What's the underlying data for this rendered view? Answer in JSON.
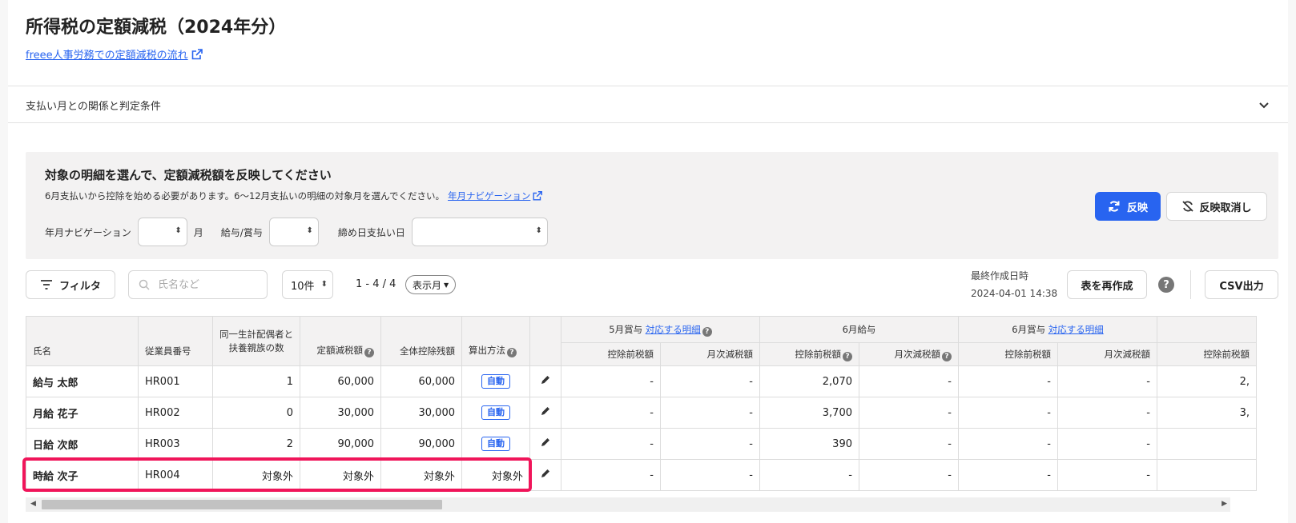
{
  "header": {
    "title": "所得税の定額減税（2024年分）",
    "flow_link": "freee人事労務での定額減税の流れ"
  },
  "accordion": {
    "label": "支払い月との関係と判定条件"
  },
  "panel": {
    "heading": "対象の明細を選んで、定額減税額を反映してください",
    "description": "6月支払いから控除を始める必要があります。6〜12月支払いの明細の対象月を選んでください。",
    "nav_link": "年月ナビゲーション",
    "fields": {
      "nav_label": "年月ナビゲーション",
      "month_unit": "月",
      "pay_type_label": "給与/賞与",
      "closing_label": "締め日支払い日"
    },
    "apply_button": "反映",
    "cancel_button": "反映取消し"
  },
  "toolbar": {
    "filter": "フィルタ",
    "search_placeholder": "氏名など",
    "per_page": "10件",
    "range": "1 - 4 / 4",
    "display_month": "表示月",
    "last_created_label": "最終作成日時",
    "last_created_value": "2024-04-01 14:38",
    "regen": "表を再作成",
    "csv": "CSV出力"
  },
  "table": {
    "headers": {
      "name": "氏名",
      "emp_no": "従業員番号",
      "dependents_l1": "同一生計配偶者と",
      "dependents_l2": "扶養親族の数",
      "reduction": "定額減税額",
      "total": "全体控除残額",
      "method": "算出方法",
      "may_bonus": "5月賞与",
      "may_bonus_link": "対応する明細",
      "jun_salary": "6月給与",
      "jun_bonus": "6月賞与",
      "jun_bonus_link": "対応する明細",
      "pre_tax": "控除前税額",
      "monthly_reduction": "月次減税額"
    },
    "rows": [
      {
        "name": "給与 太郎",
        "emp_no": "HR001",
        "dependents": "1",
        "reduction": "60,000",
        "total": "60,000",
        "method": "自動",
        "may_pre": "-",
        "may_red": "-",
        "jun_pre": "2,070",
        "jun_red": "-",
        "jb_pre": "-",
        "jb_red": "-",
        "next_pre": "2,"
      },
      {
        "name": "月給 花子",
        "emp_no": "HR002",
        "dependents": "0",
        "reduction": "30,000",
        "total": "30,000",
        "method": "自動",
        "may_pre": "-",
        "may_red": "-",
        "jun_pre": "3,700",
        "jun_red": "-",
        "jb_pre": "-",
        "jb_red": "-",
        "next_pre": "3,"
      },
      {
        "name": "日給 次郎",
        "emp_no": "HR003",
        "dependents": "2",
        "reduction": "90,000",
        "total": "90,000",
        "method": "自動",
        "may_pre": "-",
        "may_red": "-",
        "jun_pre": "390",
        "jun_red": "-",
        "jb_pre": "-",
        "jb_red": "-",
        "next_pre": ""
      },
      {
        "name": "時給 次子",
        "emp_no": "HR004",
        "dependents": "対象外",
        "reduction": "対象外",
        "total": "対象外",
        "method": "対象外",
        "may_pre": "-",
        "may_red": "-",
        "jun_pre": "-",
        "jun_red": "-",
        "jb_pre": "-",
        "jb_red": "-",
        "next_pre": ""
      }
    ]
  },
  "colors": {
    "accent": "#2864f0",
    "highlight": "#f0155a",
    "panel_bg": "#f3f2f2"
  }
}
